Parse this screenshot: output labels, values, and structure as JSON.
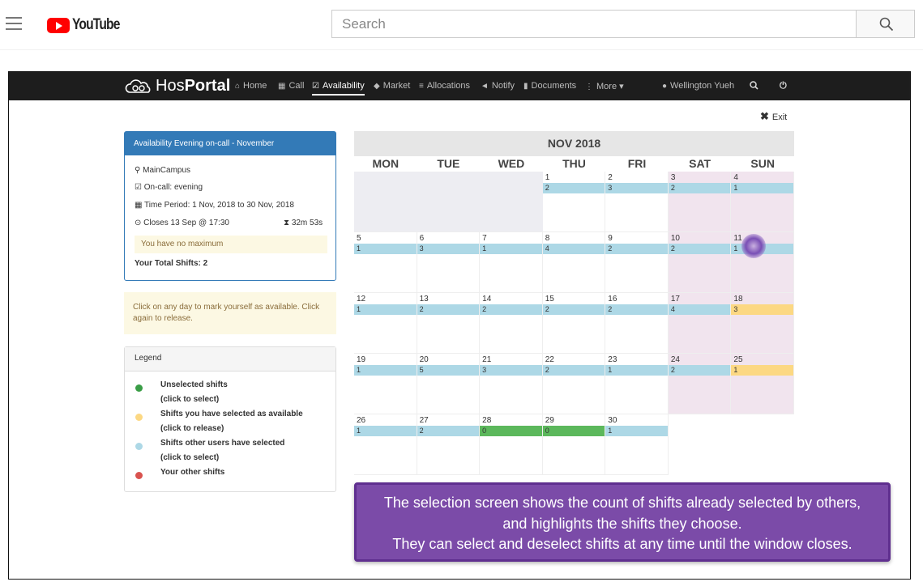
{
  "youtube": {
    "logo_text": "YouTube",
    "search_placeholder": "Search"
  },
  "nav": {
    "logo_prefix": "Hos",
    "logo_bold": "Portal",
    "items": [
      {
        "label": "Home",
        "icon": "home-icon"
      },
      {
        "label": "Call",
        "icon": "calendar-icon"
      },
      {
        "label": "Availability",
        "icon": "calendar-check-icon",
        "active": true
      },
      {
        "label": "Market",
        "icon": "tag-icon"
      },
      {
        "label": "Allocations",
        "icon": "list-icon"
      },
      {
        "label": "Notify",
        "icon": "bullhorn-icon"
      },
      {
        "label": "Documents",
        "icon": "file-icon"
      },
      {
        "label": "More",
        "icon": "vertical-dots-icon"
      }
    ],
    "user": "Wellington Yueh"
  },
  "exit_label": "Exit",
  "panel": {
    "title": "Availability Evening on-call - November",
    "campus": "MainCampus",
    "oncall": "On-call: evening",
    "period": "Time Period: 1 Nov, 2018 to 30 Nov, 2018",
    "closes": "Closes 13 Sep @ 17:30",
    "countdown": "32m 53s",
    "no_max": "You have no maximum",
    "total": "Your Total Shifts: 2"
  },
  "info": "Click on any day to mark yourself as available. Click again to release.",
  "legend": {
    "title": "Legend",
    "items": [
      {
        "line1": "Unselected shifts",
        "line2": "(click to select)",
        "color": "#3a9d46"
      },
      {
        "line1": "Shifts you have selected as available",
        "line2": "(click to release)",
        "color": "#fcd883"
      },
      {
        "line1": "Shifts other users have selected",
        "line2": "(click to select)",
        "color": "#add8e6"
      },
      {
        "line1": "Your other shifts",
        "line2": "",
        "color": "#d9534f"
      }
    ]
  },
  "calendar": {
    "title": "NOV 2018",
    "days": [
      "MON",
      "TUE",
      "WED",
      "THU",
      "FRI",
      "SAT",
      "SUN"
    ],
    "weeks": [
      [
        null,
        null,
        null,
        {
          "d": "1",
          "c": "2"
        },
        {
          "d": "2",
          "c": "3"
        },
        {
          "d": "3",
          "c": "2"
        },
        {
          "d": "4",
          "c": "1"
        }
      ],
      [
        {
          "d": "5",
          "c": "1"
        },
        {
          "d": "6",
          "c": "3"
        },
        {
          "d": "7",
          "c": "1"
        },
        {
          "d": "8",
          "c": "4"
        },
        {
          "d": "9",
          "c": "2"
        },
        {
          "d": "10",
          "c": "2"
        },
        {
          "d": "11",
          "c": "1"
        }
      ],
      [
        {
          "d": "12",
          "c": "1"
        },
        {
          "d": "13",
          "c": "2"
        },
        {
          "d": "14",
          "c": "2"
        },
        {
          "d": "15",
          "c": "2"
        },
        {
          "d": "16",
          "c": "2"
        },
        {
          "d": "17",
          "c": "4"
        },
        {
          "d": "18",
          "c": "3",
          "s": "sel"
        }
      ],
      [
        {
          "d": "19",
          "c": "1"
        },
        {
          "d": "20",
          "c": "5"
        },
        {
          "d": "21",
          "c": "3"
        },
        {
          "d": "22",
          "c": "2"
        },
        {
          "d": "23",
          "c": "1"
        },
        {
          "d": "24",
          "c": "2"
        },
        {
          "d": "25",
          "c": "1",
          "s": "sel"
        }
      ],
      [
        {
          "d": "26",
          "c": "1"
        },
        {
          "d": "27",
          "c": "2"
        },
        {
          "d": "28",
          "c": "0",
          "s": "uns"
        },
        {
          "d": "29",
          "c": "0",
          "s": "uns"
        },
        {
          "d": "30",
          "c": "1"
        },
        "blank",
        "blank"
      ]
    ]
  },
  "caption": [
    "The selection screen shows the count of shifts already selected by others,",
    "and highlights the shifts they choose.",
    "They can select and deselect shifts at any time until the window closes."
  ]
}
